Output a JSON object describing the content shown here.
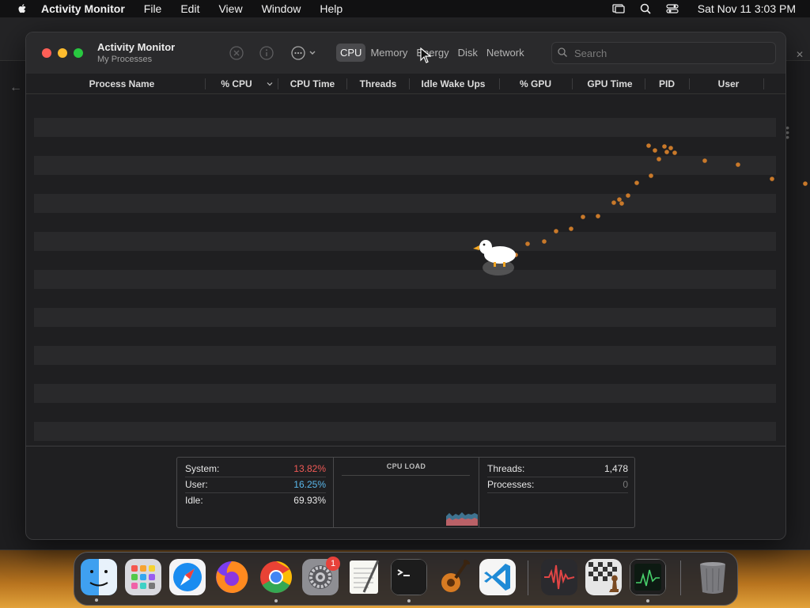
{
  "menubar": {
    "app_name": "Activity Monitor",
    "items": [
      "File",
      "Edit",
      "View",
      "Window",
      "Help"
    ],
    "clock": "Sat Nov 11  3:03 PM"
  },
  "window": {
    "title": "Activity Monitor",
    "subtitle": "My Processes",
    "tabs": [
      "CPU",
      "Memory",
      "Energy",
      "Disk",
      "Network"
    ],
    "active_tab": "CPU",
    "search_placeholder": "Search"
  },
  "table": {
    "columns": [
      "Process Name",
      "% CPU",
      "CPU Time",
      "Threads",
      "Idle Wake Ups",
      "% GPU",
      "GPU Time",
      "PID",
      "User"
    ],
    "sorted_column": "% CPU",
    "rows": []
  },
  "stats": {
    "system_label": "System:",
    "system_value": "13.82%",
    "user_label": "User:",
    "user_value": "16.25%",
    "idle_label": "Idle:",
    "idle_value": "69.93%",
    "cpu_load_title": "CPU LOAD",
    "threads_label": "Threads:",
    "threads_value": "1,478",
    "processes_label": "Processes:",
    "processes_value": "0",
    "colors": {
      "system": "#f05a56",
      "user": "#5ab8ec",
      "idle": "#e6e6e6"
    }
  },
  "dock": {
    "items": [
      "finder",
      "launchpad",
      "safari",
      "firefox",
      "chrome",
      "system-settings",
      "textedit",
      "terminal",
      "garageband",
      "vscode",
      "audio-app",
      "chess",
      "activity-monitor",
      "trash"
    ],
    "settings_badge": "1"
  }
}
